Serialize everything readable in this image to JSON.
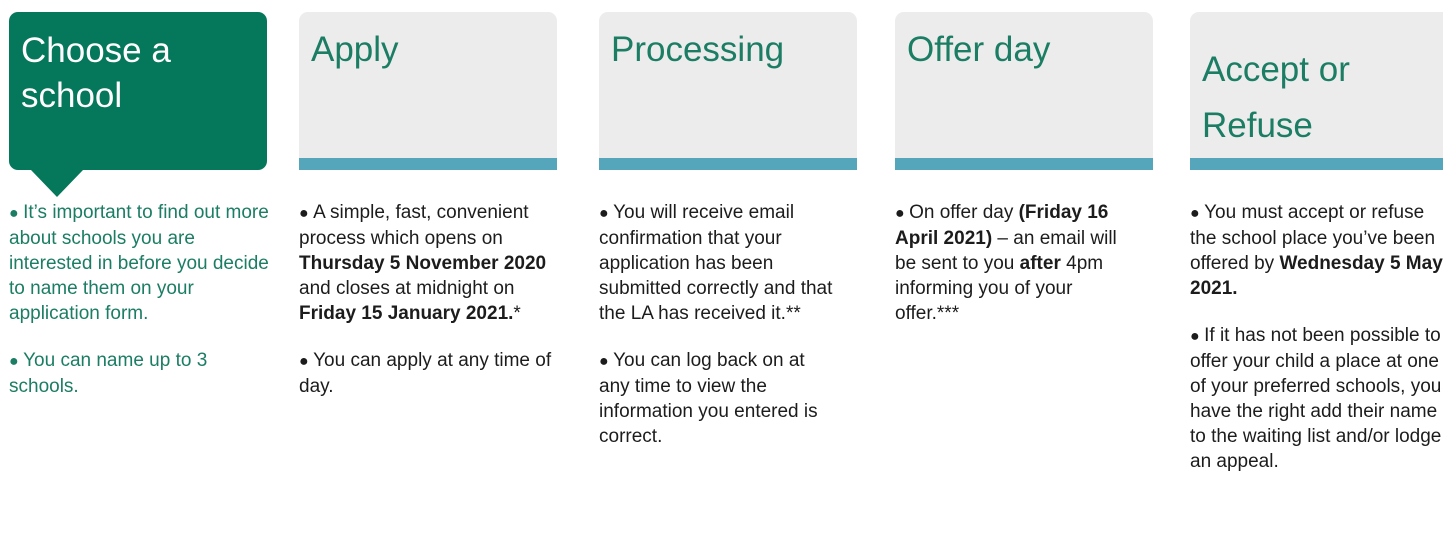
{
  "steps": [
    {
      "title": [
        "Choose a",
        "school"
      ],
      "active": true,
      "paragraphs": [
        [
          {
            "t": "It’s important to find out more about schools you are interested in before you decide to name them on your application form."
          }
        ],
        [
          {
            "t": "You can name up to 3 schools."
          }
        ]
      ]
    },
    {
      "title": [
        "Apply"
      ],
      "active": false,
      "paragraphs": [
        [
          {
            "t": "A simple, fast, convenient process which opens on "
          },
          {
            "t": "Thursday 5 November 2020",
            "b": true
          },
          {
            "t": " and closes at midnight on "
          },
          {
            "t": "Friday 15 January 2021.",
            "b": true
          },
          {
            "t": "*"
          }
        ],
        [
          {
            "t": "You can apply at any time of day."
          }
        ]
      ]
    },
    {
      "title": [
        "Processing"
      ],
      "active": false,
      "paragraphs": [
        [
          {
            "t": "You will receive email confirmation that your application has been submitted correctly and that the LA has received it.**"
          }
        ],
        [
          {
            "t": "You can log back on at any time to view the information you entered is correct."
          }
        ]
      ]
    },
    {
      "title": [
        "Offer day"
      ],
      "active": false,
      "paragraphs": [
        [
          {
            "t": "On offer day "
          },
          {
            "t": "(Friday 16 April 2021)",
            "b": true
          },
          {
            "t": " – an email will be sent to you "
          },
          {
            "t": "after",
            "b": true
          },
          {
            "t": " 4pm informing you of your offer.***"
          }
        ]
      ]
    },
    {
      "title": [
        "Accept or",
        "Refuse"
      ],
      "active": false,
      "paragraphs": [
        [
          {
            "t": "You must accept or refuse the school place you’ve been offered by "
          },
          {
            "t": "Wednesday 5 May 2021.",
            "b": true
          }
        ],
        [
          {
            "t": "If it has not been possible to offer your child a place at one of your preferred schools, you have the right add their name to the waiting list and/or lodge an appeal."
          }
        ]
      ]
    }
  ]
}
